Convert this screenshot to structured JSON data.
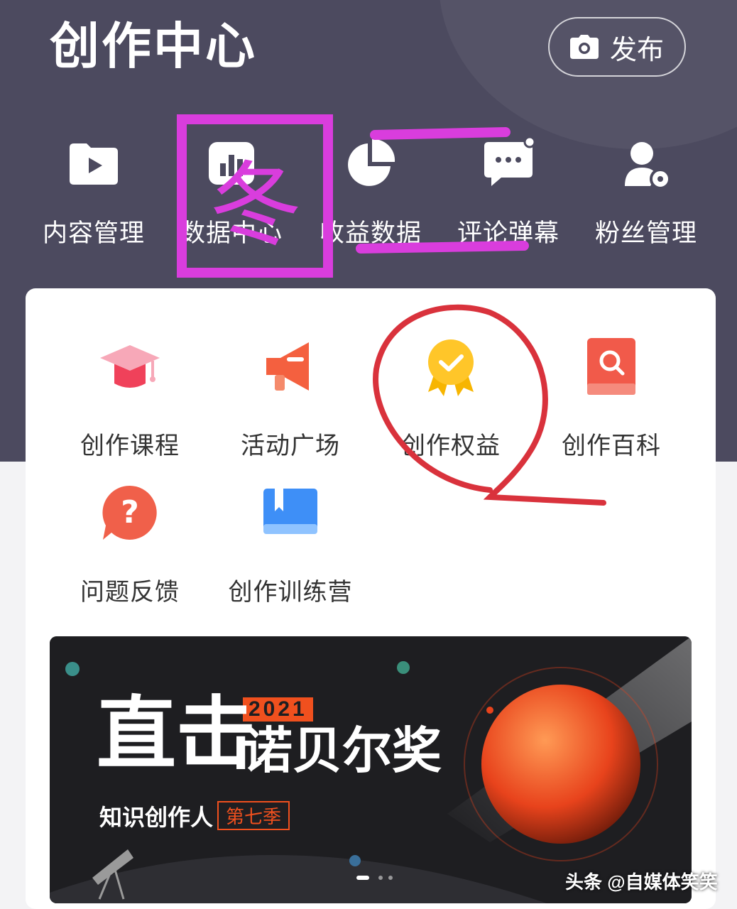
{
  "header": {
    "title": "创作中心",
    "publish_label": "发布",
    "bg_color": "#4c4a5f"
  },
  "tools": [
    {
      "label": "内容管理",
      "icon": "folder-play-icon"
    },
    {
      "label": "数据中心",
      "icon": "data-center-icon"
    },
    {
      "label": "收益数据",
      "icon": "pie-chart-icon"
    },
    {
      "label": "评论弹幕",
      "icon": "comment-icon"
    },
    {
      "label": "粉丝管理",
      "icon": "fans-icon"
    }
  ],
  "services": [
    {
      "label": "创作课程",
      "icon": "graduation-cap-icon"
    },
    {
      "label": "活动广场",
      "icon": "megaphone-icon"
    },
    {
      "label": "创作权益",
      "icon": "medal-icon"
    },
    {
      "label": "创作百科",
      "icon": "encyclopedia-icon"
    },
    {
      "label": "问题反馈",
      "icon": "question-icon"
    },
    {
      "label": "创作训练营",
      "icon": "book-icon"
    }
  ],
  "banner": {
    "year": "2021",
    "headline_left": "直击",
    "headline_right": "诺贝尔奖",
    "subtitle": "知识创作人",
    "season": "第七季"
  },
  "watermark": "头条 @自媒体笑笑",
  "annotations": {
    "note_1": "冬",
    "note_2": "二",
    "note_3": "Q",
    "ink_color": "#d93ddd",
    "circle_color": "#d9323c"
  }
}
